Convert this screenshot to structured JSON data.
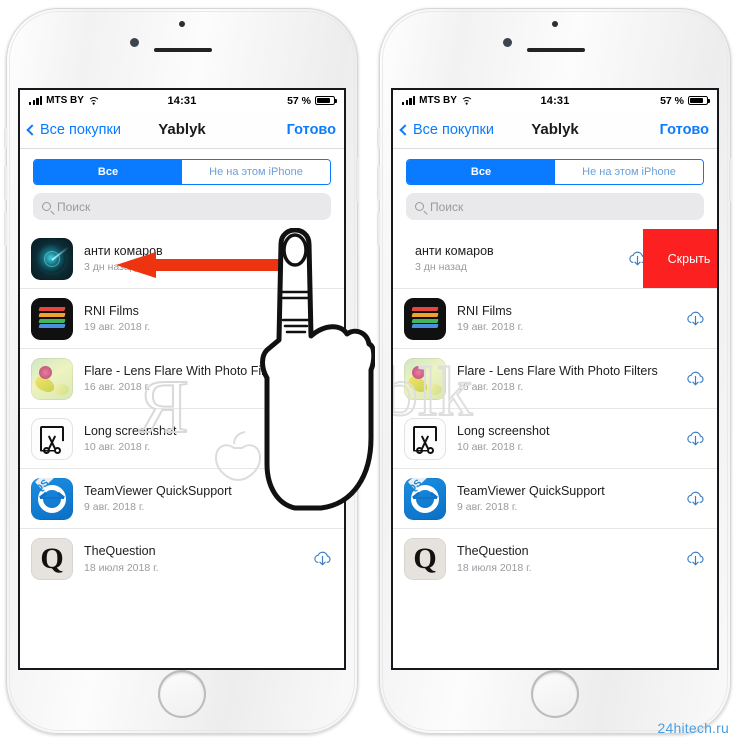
{
  "watermark": {
    "site": "24hitech.ru",
    "brand": "Yablyk"
  },
  "status_bar": {
    "carrier": "MTS BY",
    "time": "14:31",
    "battery_percent": "57 %",
    "wifi_icon": "wifi-icon",
    "signal_icon": "signal-bars-icon",
    "battery_icon": "battery-icon"
  },
  "nav_bar": {
    "back_label": "Все покупки",
    "title": "Yablyk",
    "done_label": "Готово",
    "back_icon": "chevron-left-icon"
  },
  "segmented_control": {
    "options": [
      "Все",
      "Не на этом iPhone"
    ],
    "selected": "Все",
    "accent_color": "#0a7bff"
  },
  "search": {
    "placeholder": "Поиск",
    "icon": "search-icon"
  },
  "swipe_action": {
    "label": "Скрыть",
    "color": "#fc2020"
  },
  "apps": [
    {
      "name": "анти комаров",
      "date": "3 дн назад",
      "icon": "mosquito-repellent-icon",
      "cloud": true
    },
    {
      "name": "RNI Films",
      "date": "19 авг. 2018 г.",
      "icon": "rni-films-icon",
      "cloud": true
    },
    {
      "name": "Flare - Lens Flare With Photo Filters",
      "date": "16 авг. 2018 г.",
      "icon": "flare-icon",
      "cloud": true
    },
    {
      "name": "Long screenshot",
      "date": "10 авг. 2018 г.",
      "icon": "long-screenshot-icon",
      "cloud": true
    },
    {
      "name": "TeamViewer QuickSupport",
      "date": "9 авг. 2018 г.",
      "icon": "teamviewer-icon",
      "cloud": true
    },
    {
      "name": "TheQuestion",
      "date": "18 июля 2018 г.",
      "icon": "thequestion-icon",
      "cloud": true
    }
  ],
  "annotations": {
    "arrow_color": "#ee3311",
    "arrow_direction": "left",
    "hand_gesture": "pointing-finger-swipe"
  },
  "phones": {
    "left": {
      "caption": "swipe gesture demonstrated"
    },
    "right": {
      "caption": "revealed hide action"
    }
  }
}
